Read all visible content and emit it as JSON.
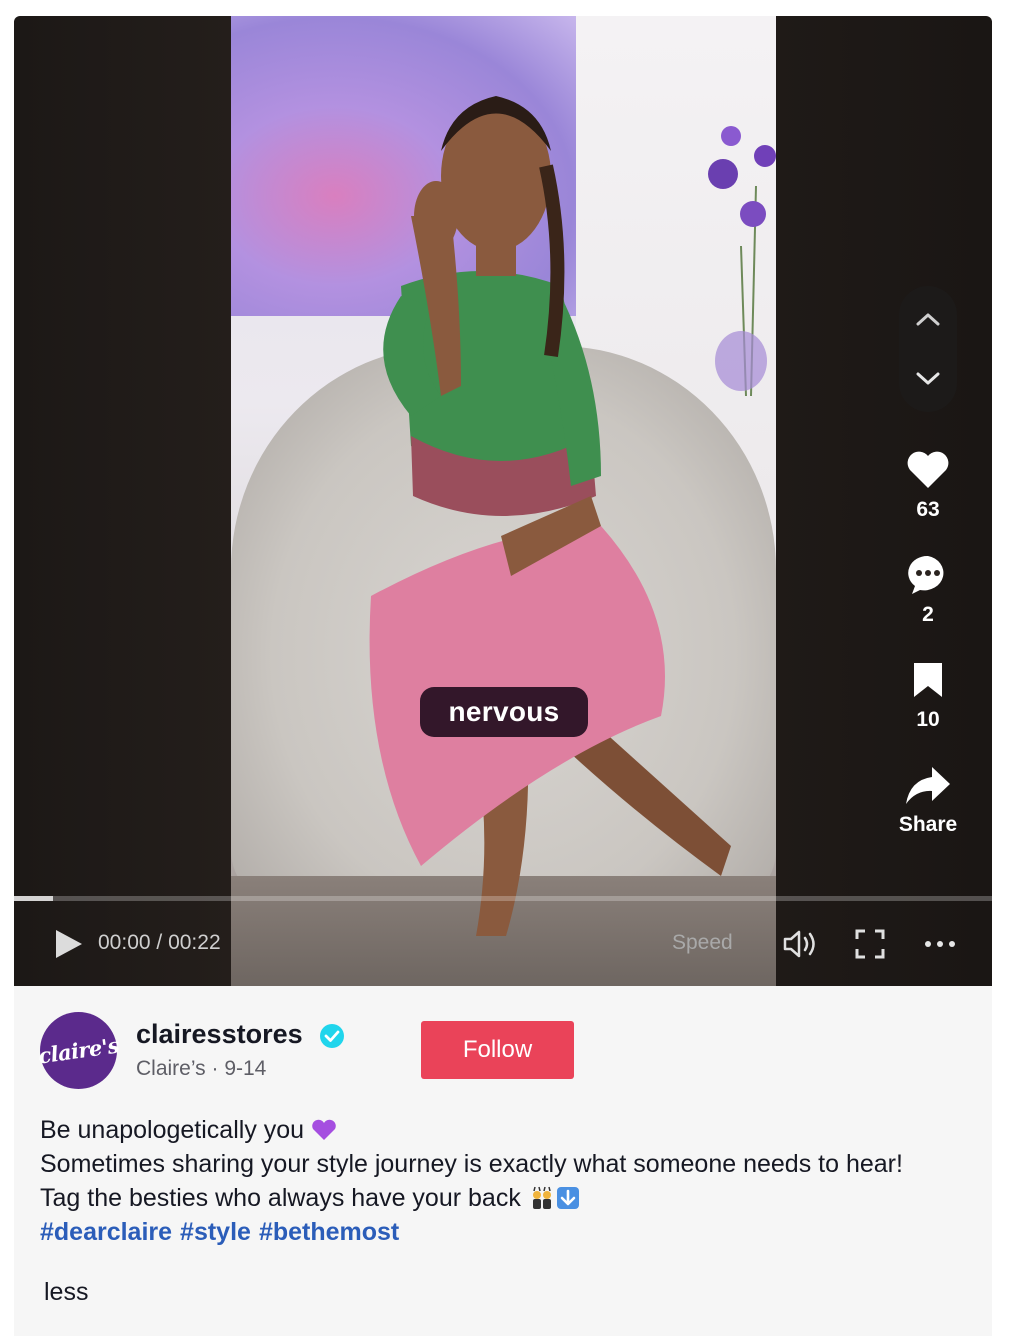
{
  "video": {
    "caption": "nervous",
    "current_time": "00:00",
    "duration": "00:22",
    "time_separator": " / ",
    "speed_label": "Speed",
    "progress_fraction": 0.04
  },
  "actions": {
    "likes": "63",
    "comments": "2",
    "saves": "10",
    "share_label": "Share"
  },
  "author": {
    "avatar_text": "claire's",
    "username": "clairesstores",
    "display_name": "Claire’s",
    "date": "9-14",
    "verified": true,
    "follow_label": "Follow"
  },
  "description": {
    "line1": "Be unapologetically you",
    "line2": "Sometimes sharing your style journey is exactly what someone needs to hear!",
    "line3": "Tag the besties who always have your back",
    "line1_emoji": "purple-heart",
    "line3_emojis": [
      "women-with-bunny-ears",
      "down-arrow"
    ],
    "hashtags": [
      "#dearclaire",
      "#style",
      "#bethemost"
    ],
    "less_label": "less"
  },
  "colors": {
    "follow": "#ea4359",
    "hashtag": "#2b5db9",
    "caption_bg": "#33172a",
    "avatar_bg": "#5b2a8c",
    "verified": "#20d5ec"
  }
}
